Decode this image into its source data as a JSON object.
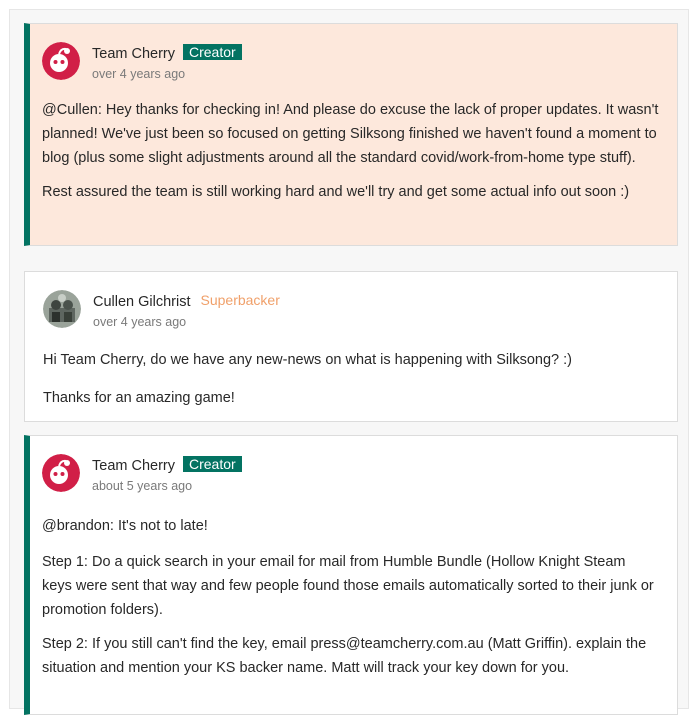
{
  "comments": [
    {
      "author": "Team Cherry",
      "badge": "Creator",
      "time": "over 4 years ago",
      "paragraphs": [
        "@Cullen: Hey thanks for checking in! And please do excuse the lack of proper updates. It wasn't planned! We've just been so focused on getting Silksong finished we haven't found a moment to blog (plus some slight adjustments around all the standard covid/work-from-home type stuff).",
        "Rest assured the team is still working hard and we'll try and get some actual info out soon :)"
      ]
    },
    {
      "author": "Cullen Gilchrist",
      "badge": "Superbacker",
      "time": "over 4 years ago",
      "paragraphs": [
        "Hi Team Cherry, do we have any new-news on what is happening with Silksong? :)",
        "Thanks for an amazing game!"
      ]
    },
    {
      "author": "Team Cherry",
      "badge": "Creator",
      "time": "about 5 years ago",
      "paragraphs": [
        "@brandon: It's not to late!",
        "Step 1: Do a quick search in your email for mail from Humble Bundle (Hollow Knight Steam keys were sent that way and few people found those emails automatically sorted to their junk or promotion folders).",
        "Step 2: If you still can't find the key, email press@teamcherry.com.au (Matt Griffin). explain the situation and mention your KS backer name. Matt will track your key down for you."
      ]
    }
  ],
  "colors": {
    "creator_accent": "#037362",
    "creator_background": "#fde8dc",
    "superbacker_text": "#f0a06a",
    "team_cherry_avatar": "#d11f47"
  }
}
